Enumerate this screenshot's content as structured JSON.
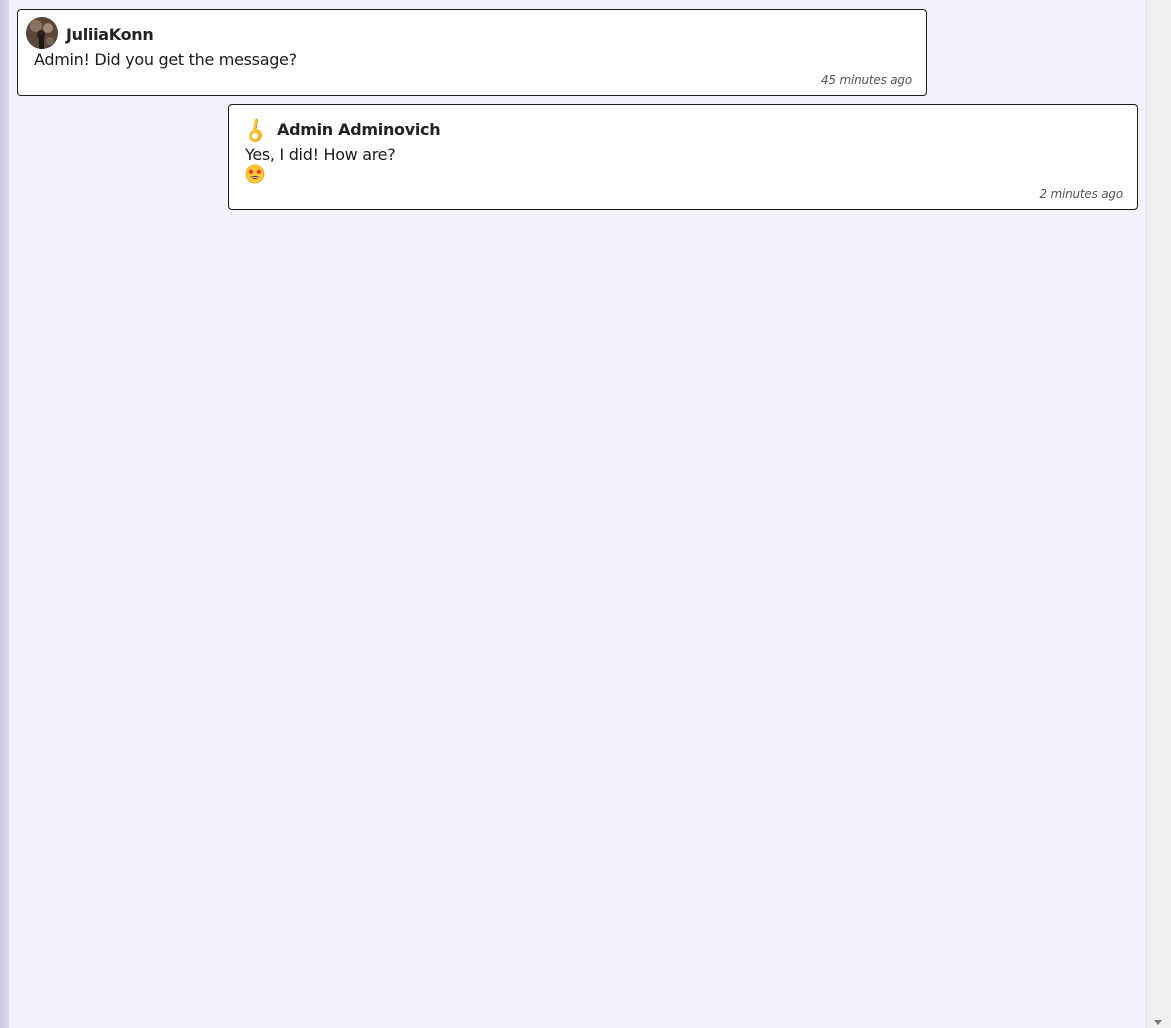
{
  "messages": [
    {
      "author": "JuliiaKonn",
      "text": "Admin! Did you get the message?",
      "time": "45 minutes ago",
      "avatar_icon": "user-photo-avatar"
    },
    {
      "author": "Admin Adminovich",
      "text": "Yes, I did! How are?",
      "emoji_icon": "star-struck-emoji-icon",
      "time": "2 minutes ago",
      "avatar_icon": "ok-hand-avatar-icon"
    }
  ],
  "colors": {
    "background": "#f1f2fb",
    "bubble": "#ffffff",
    "border": "#1a1a1a",
    "text": "#1c1c1c",
    "timestamp": "#555555"
  }
}
